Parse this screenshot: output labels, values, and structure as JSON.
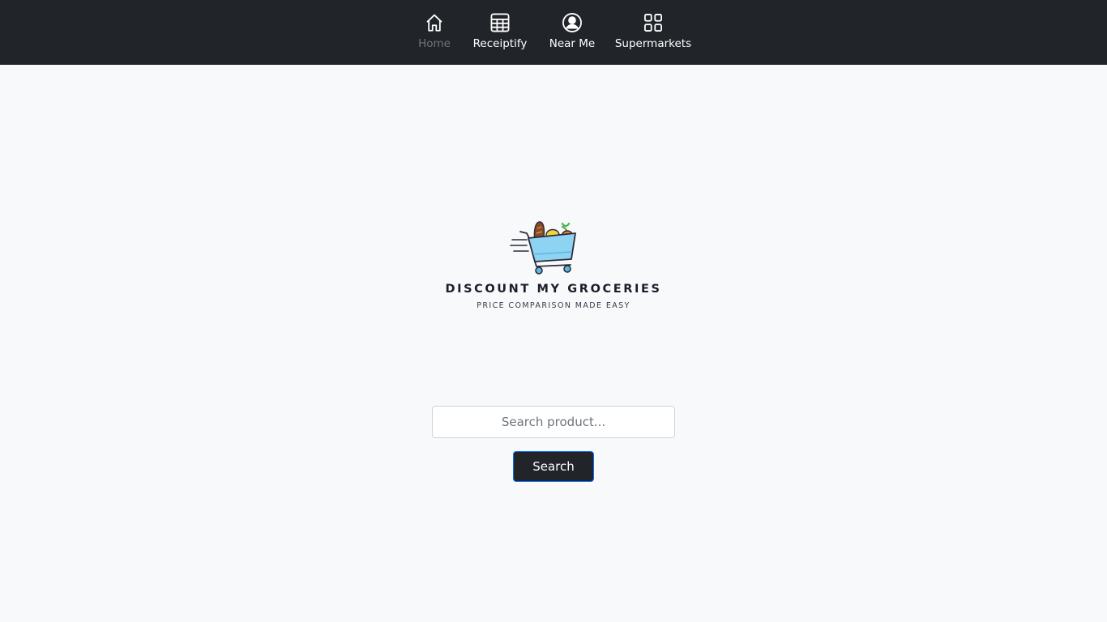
{
  "nav": {
    "items": [
      {
        "label": "Home",
        "icon": "home-icon",
        "active": true
      },
      {
        "label": "Receiptify",
        "icon": "table-icon",
        "active": false
      },
      {
        "label": "Near Me",
        "icon": "person-circle-icon",
        "active": false
      },
      {
        "label": "Supermarkets",
        "icon": "grid-icon",
        "active": false
      }
    ]
  },
  "brand": {
    "name": "DISCOUNT MY GROCERIES",
    "tagline": "PRICE COMPARISON MADE EASY",
    "logo_icon": "grocery-cart-icon"
  },
  "search": {
    "placeholder": "Search product...",
    "value": "",
    "button_label": "Search"
  },
  "colors": {
    "navbar_bg": "#212529",
    "page_bg": "#f8f9fa",
    "button_bg": "#212529",
    "button_border": "#0d6efd",
    "active_nav_text": "#6c757d"
  }
}
